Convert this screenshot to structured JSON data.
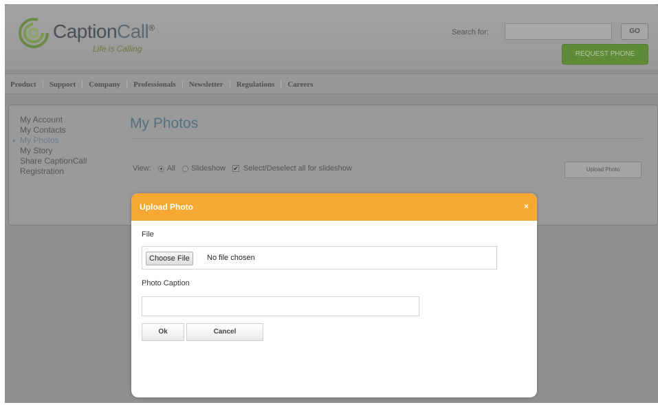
{
  "brand": {
    "name_part1": "Caption",
    "name_part2": "Call",
    "trademark": "®",
    "tagline": "Life is Calling"
  },
  "header": {
    "search_label": "Search for:",
    "search_value": "",
    "go_label": "GO",
    "request_label": "REQUEST PHONE"
  },
  "nav": {
    "items": [
      {
        "label": "Product"
      },
      {
        "label": "Support"
      },
      {
        "label": "Company"
      },
      {
        "label": "Professionals"
      },
      {
        "label": "Newsletter"
      },
      {
        "label": "Regulations"
      },
      {
        "label": "Careers"
      }
    ]
  },
  "sidebar": {
    "items": [
      {
        "label": "My Account"
      },
      {
        "label": "My Contacts"
      },
      {
        "label": "My Photos"
      },
      {
        "label": "My Story"
      },
      {
        "label": "Share CaptionCall"
      },
      {
        "label": "Registration"
      }
    ],
    "active_index": 2
  },
  "main": {
    "title": "My Photos",
    "view_label": "View:",
    "view_all": "All",
    "view_slideshow": "Slideshow",
    "select_all": "Select/Deselect all for slideshow",
    "upload_button": "Upload Photo"
  },
  "modal": {
    "title": "Upload Photo",
    "close": "×",
    "file_label": "File",
    "choose_file": "Choose File",
    "no_file": "No file chosen",
    "caption_label": "Photo Caption",
    "caption_value": "",
    "ok": "Ok",
    "cancel": "Cancel",
    "header_color": "#f5a933"
  },
  "colors": {
    "overlay": "#8f8f8f",
    "accent_green": "#5f8a37",
    "title_blue": "#52707e"
  }
}
